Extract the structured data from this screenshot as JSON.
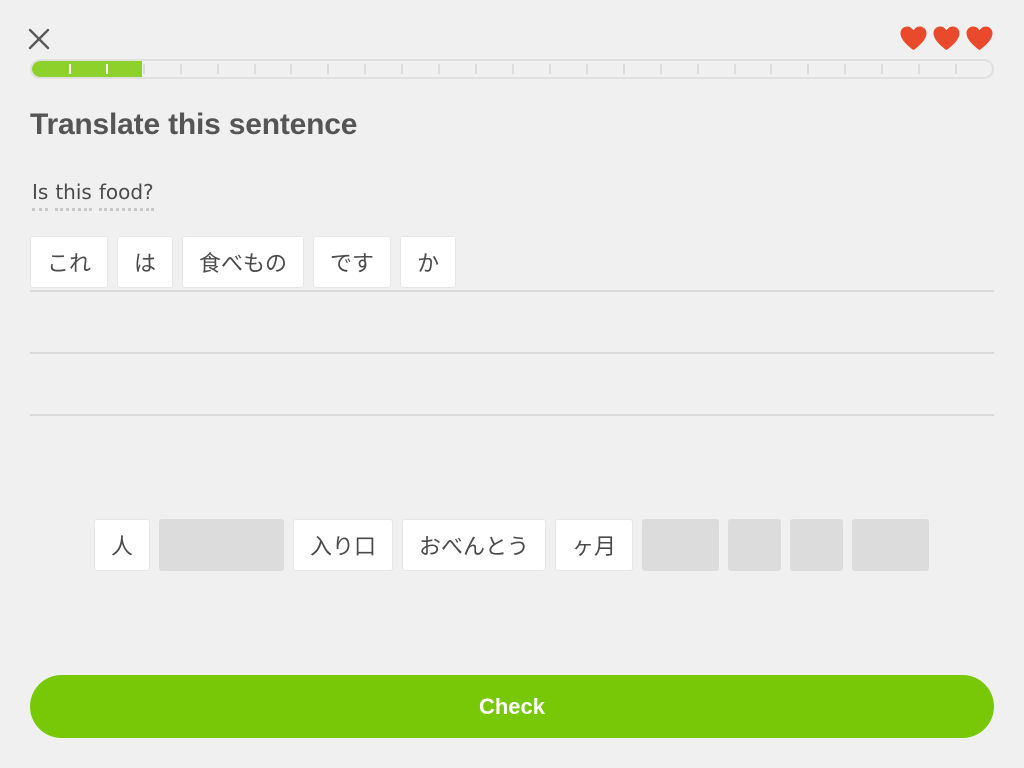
{
  "header": {
    "close_icon": "close-icon",
    "hearts": {
      "count": 3,
      "icon": "heart-icon",
      "color": "#ea4a2c"
    },
    "progress": {
      "completed_fraction": 0.115,
      "total_segments": 26,
      "done_segments": 3,
      "fill_color": "#8ed12a"
    }
  },
  "exercise": {
    "title": "Translate this sentence",
    "prompt_words": [
      "Is",
      "this",
      "food?"
    ],
    "answer_words": [
      "これ",
      "は",
      "食べもの",
      "です",
      "か"
    ]
  },
  "word_bank": {
    "items": [
      {
        "type": "word",
        "label": "人"
      },
      {
        "type": "slot"
      },
      {
        "type": "word",
        "label": "入り口"
      },
      {
        "type": "word",
        "label": "おべんとう"
      },
      {
        "type": "word",
        "label": "ヶ月"
      },
      {
        "type": "slot"
      },
      {
        "type": "slot"
      },
      {
        "type": "slot"
      },
      {
        "type": "slot"
      }
    ]
  },
  "footer": {
    "check_label": "Check",
    "accent_color": "#78c808"
  }
}
